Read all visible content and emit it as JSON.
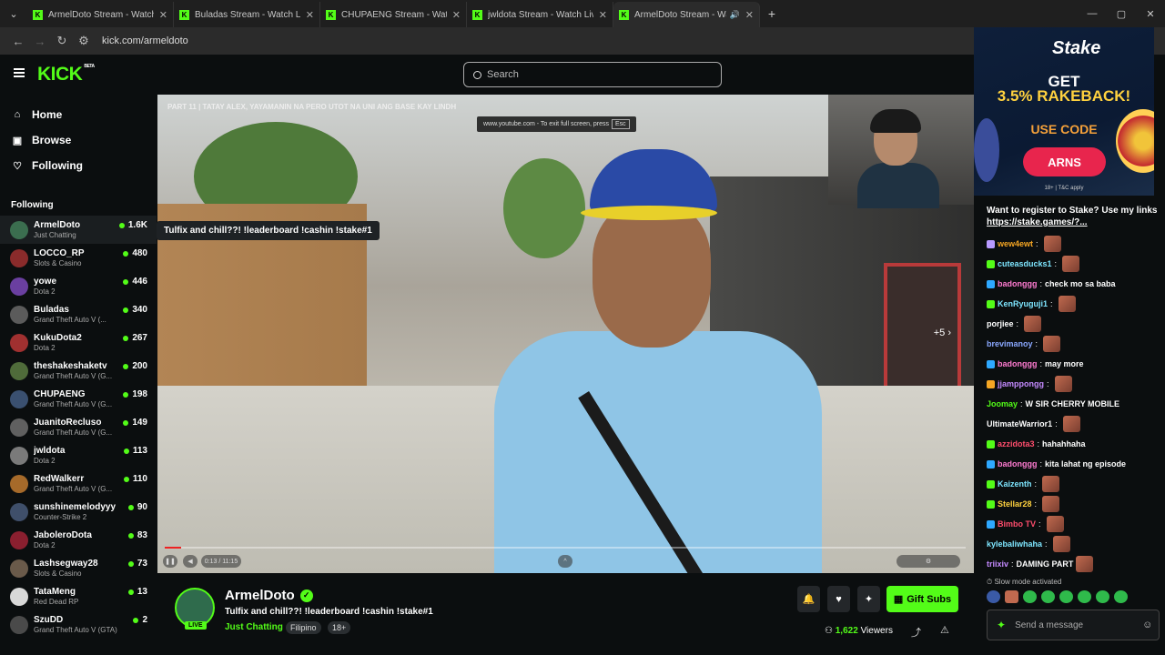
{
  "browser": {
    "tabs": [
      {
        "title": "ArmelDoto Stream - Watch Live"
      },
      {
        "title": "Buladas Stream - Watch Live on"
      },
      {
        "title": "CHUPAENG Stream - Watch Live"
      },
      {
        "title": "jwldota Stream - Watch Live on"
      },
      {
        "title": "ArmelDoto Stream - Watch"
      }
    ],
    "url": "kick.com/armeldoto"
  },
  "header": {
    "logo": "KICK",
    "logo_sup": "BETA",
    "search_placeholder": "Search"
  },
  "nav": {
    "home": "Home",
    "browse": "Browse",
    "following": "Following"
  },
  "following_header": "Following",
  "channels": [
    {
      "name": "ArmelDoto",
      "category": "Just Chatting",
      "viewers": "1.6K",
      "color": "#3b6e4f"
    },
    {
      "name": "LOCCO_RP",
      "category": "Slots & Casino",
      "viewers": "480",
      "color": "#8a2b2b"
    },
    {
      "name": "yowe",
      "category": "Dota 2",
      "viewers": "446",
      "color": "#6a3fa0"
    },
    {
      "name": "Buladas",
      "category": "Grand Theft Auto V (...",
      "viewers": "340",
      "color": "#5b5b5b"
    },
    {
      "name": "KukuDota2",
      "category": "Dota 2",
      "viewers": "267",
      "color": "#a03030"
    },
    {
      "name": "theshakeshaketv",
      "category": "Grand Theft Auto V (G...",
      "viewers": "200",
      "color": "#4f6b3a"
    },
    {
      "name": "CHUPAENG",
      "category": "Grand Theft Auto V (G...",
      "viewers": "198",
      "color": "#3a5070"
    },
    {
      "name": "JuanitoRecluso",
      "category": "Grand Theft Auto V (G...",
      "viewers": "149",
      "color": "#606060"
    },
    {
      "name": "jwldota",
      "category": "Dota 2",
      "viewers": "113",
      "color": "#7a7a7a"
    },
    {
      "name": "RedWalkerr",
      "category": "Grand Theft Auto V (G...",
      "viewers": "110",
      "color": "#a66a2a"
    },
    {
      "name": "sunshinemelodyyy",
      "category": "Counter-Strike 2",
      "viewers": "90",
      "color": "#3f4f6a"
    },
    {
      "name": "JaboleroDota",
      "category": "Dota 2",
      "viewers": "83",
      "color": "#8a1f2f"
    },
    {
      "name": "Lashsegway28",
      "category": "Slots & Casino",
      "viewers": "73",
      "color": "#6a5a4a"
    },
    {
      "name": "TataMeng",
      "category": "Red Dead RP",
      "viewers": "13",
      "color": "#d8d8d8"
    },
    {
      "name": "SzuDD",
      "category": "Grand Theft Auto V (GTA)",
      "viewers": "2",
      "color": "#4a4a4a"
    }
  ],
  "tooltip": "Tulfix and chill??! !leaderboard !cashin !stake#1",
  "video": {
    "overlay_title": "PART 11 | TATAY ALEX, YAYAMANIN NA PERO UTOT NA UNI ANG BASE KAY LINDH",
    "fullscreen_note": "www.youtube.com - To exit full screen, press",
    "esc_key": "Esc",
    "plus_more": "+5",
    "time": "0:13 / 11:15",
    "progress": 0.02
  },
  "stream": {
    "name": "ArmelDoto",
    "title": "Tulfix and chill??! !leaderboard !cashin !stake#1",
    "category": "Just Chatting",
    "tags": [
      "Filipino",
      "18+"
    ],
    "live": "LIVE",
    "gift_subs": "Gift Subs",
    "viewers": "1,622",
    "viewers_label": "Viewers"
  },
  "ad": {
    "brand": "Stake",
    "line1": "GET",
    "line2": "3.5% RAKEBACK!",
    "line3": "USE CODE",
    "code": "ARNS",
    "fine": "18+ | T&C apply"
  },
  "chat": {
    "pinned": "Want to register to Stake? Use my links",
    "pinned_link": "https://stake.games/?...",
    "messages": [
      {
        "user": "wew4ewt",
        "text": "",
        "color": "#f5a623",
        "badge": "#b89aff",
        "emote": true
      },
      {
        "user": "cuteasducks1",
        "text": "",
        "color": "#7ee6ff",
        "badge": "#53fc18",
        "emote": true
      },
      {
        "user": "badonggg",
        "text": "check mo sa baba",
        "color": "#ff7bd1",
        "badge": "#2ea8ff",
        "emote": false
      },
      {
        "user": "KenRyuguji1",
        "text": "",
        "color": "#7ee6ff",
        "badge": "#53fc18",
        "emote": true
      },
      {
        "user": "porjiee",
        "text": "",
        "color": "#ffffff",
        "badge": "",
        "emote": true
      },
      {
        "user": "brevimanoy",
        "text": "",
        "color": "#8aa8ff",
        "badge": "",
        "emote": true
      },
      {
        "user": "badonggg",
        "text": "may more",
        "color": "#ff7bd1",
        "badge": "#2ea8ff",
        "emote": false
      },
      {
        "user": "jjamppongg",
        "text": "",
        "color": "#c48aff",
        "badge": "#f5a623",
        "emote": true
      },
      {
        "user": "Joomay",
        "text": "W SIR CHERRY MOBILE",
        "color": "#53fc18",
        "badge": "",
        "emote": false
      },
      {
        "user": "UltimateWarrior1",
        "text": "",
        "color": "#ffffff",
        "badge": "",
        "emote": true
      },
      {
        "user": "azzidota3",
        "text": "hahahhaha",
        "color": "#ff4d6d",
        "badge": "#53fc18",
        "emote": false
      },
      {
        "user": "badonggg",
        "text": "kita lahat ng episode",
        "color": "#ff7bd1",
        "badge": "#2ea8ff",
        "emote": false
      },
      {
        "user": "Kaizenth",
        "text": "",
        "color": "#7ee6ff",
        "badge": "#53fc18",
        "emote": true
      },
      {
        "user": "Stellar28",
        "text": "",
        "color": "#ffd23f",
        "badge": "#53fc18",
        "emote": true
      },
      {
        "user": "Bimbo TV",
        "text": "",
        "color": "#ff4d6d",
        "badge": "#2ea8ff",
        "emote": true
      },
      {
        "user": "kylebaliwhaha",
        "text": "",
        "color": "#7ee6ff",
        "badge": "",
        "emote": true
      },
      {
        "user": "triixiv",
        "text": "DAMING PART",
        "color": "#c48aff",
        "badge": "",
        "emote": true
      }
    ],
    "slow_mode": "Slow mode activated",
    "input_placeholder": "Send a message"
  }
}
